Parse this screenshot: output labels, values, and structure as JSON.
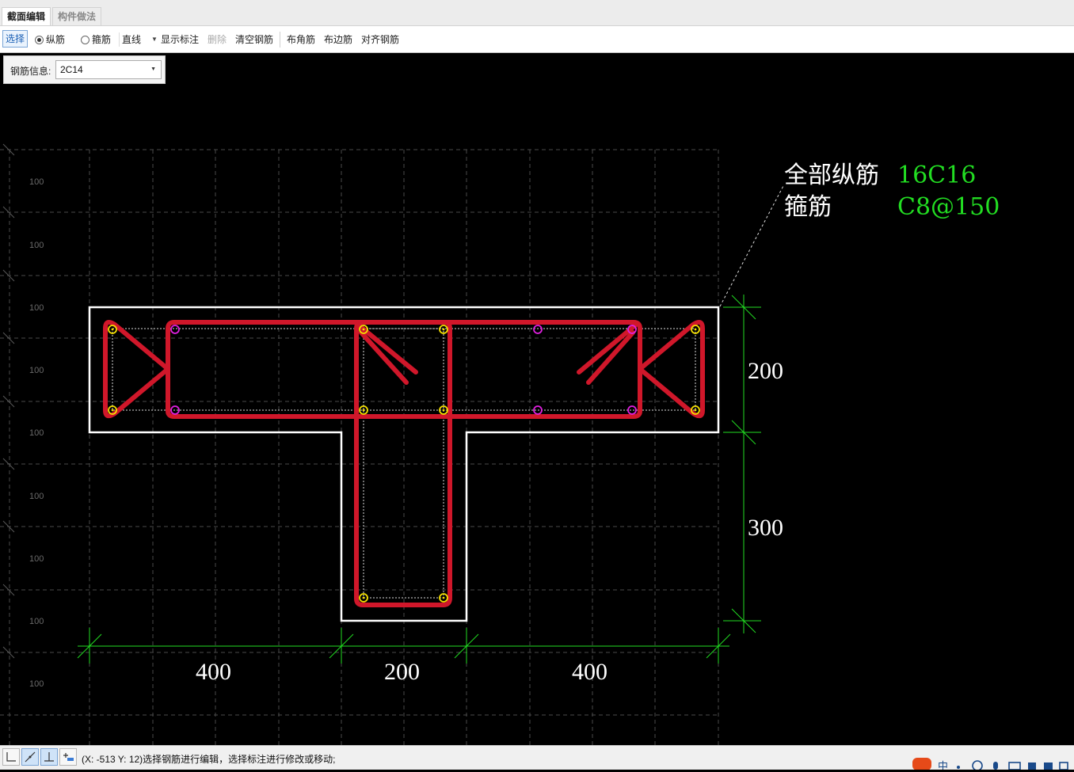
{
  "tabs": [
    {
      "label": "截面编辑",
      "active": true
    },
    {
      "label": "构件做法",
      "active": false
    }
  ],
  "toolbar": {
    "select_label": "选择",
    "radio_longitudinal": "纵筋",
    "radio_stirrup": "箍筋",
    "line_type": "直线",
    "show_dims": "显示标注",
    "delete": "删除",
    "clear_rebar": "清空钢筋",
    "corner_rebar": "布角筋",
    "side_rebar": "布边筋",
    "align_rebar": "对齐钢筋"
  },
  "rebar_info": {
    "label": "钢筋信息:",
    "value": "2C14"
  },
  "section": {
    "all_long_label": "全部纵筋",
    "all_long_value": "16C16",
    "stirrup_label": "箍筋",
    "stirrup_value": "C8@150",
    "dim_flange_left": "400",
    "dim_web": "200",
    "dim_flange_right": "400",
    "dim_flange_height": "200",
    "dim_web_height": "300"
  },
  "grid_labels": [
    "100",
    "100",
    "100",
    "100",
    "100",
    "100",
    "100",
    "100",
    "100"
  ],
  "status": {
    "text": "(X: -513 Y: 12)选择钢筋进行编辑，选择标注进行修改或移动;"
  },
  "colors": {
    "rebar": "#d0172a",
    "outline": "#ffffff",
    "dimension": "#22dd22",
    "corner_bar": "#f5e000",
    "side_bar": "#e020e0",
    "grid": "#4a4a4a",
    "note_value": "#22dd22"
  }
}
